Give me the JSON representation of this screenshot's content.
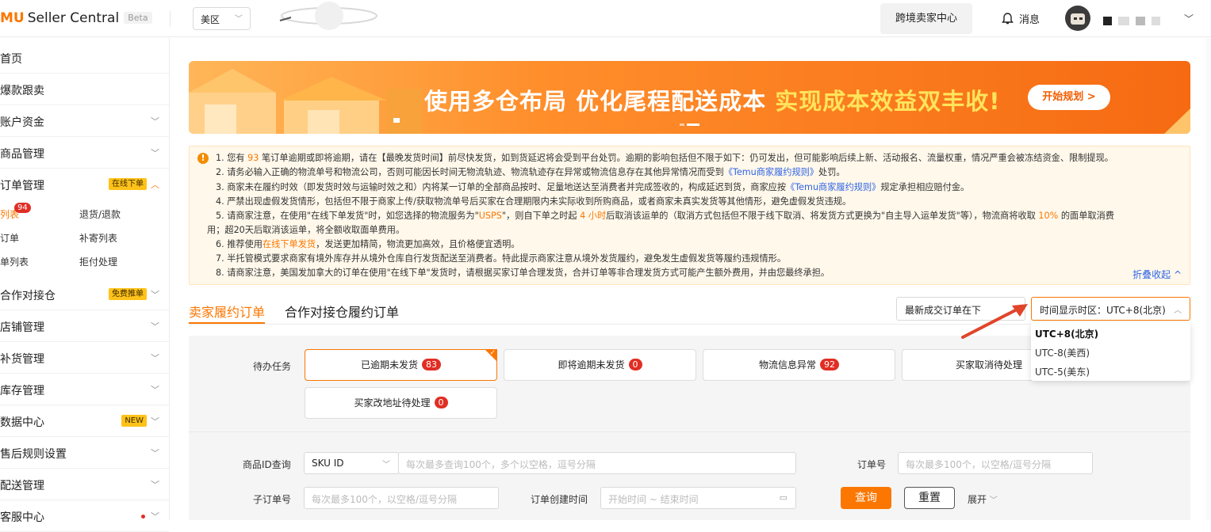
{
  "header": {
    "logo_mark": "MU",
    "logo_text": "Seller Central",
    "beta": "Beta",
    "region": "美区",
    "cross_border": "跨境卖家中心",
    "messages": "消息"
  },
  "sidebar": {
    "items": [
      {
        "label": "首页"
      },
      {
        "label": "爆款跟卖"
      },
      {
        "label": "账户资金"
      },
      {
        "label": "商品管理"
      },
      {
        "label": "订单管理",
        "badge": "在线下单"
      },
      {
        "label": "合作对接仓",
        "badge": "免费推单"
      },
      {
        "label": "店铺管理"
      },
      {
        "label": "补货管理"
      },
      {
        "label": "库存管理"
      },
      {
        "label": "数据中心",
        "badge": "NEW"
      },
      {
        "label": "售后规则设置"
      },
      {
        "label": "配送管理"
      },
      {
        "label": "客服中心"
      }
    ],
    "order_sub": {
      "list": "列表",
      "list_count": "94",
      "returns": "退货/退款",
      "orders": "订单",
      "resend": "补寄列表",
      "shiplist": "单列表",
      "chargeback": "拒付处理"
    }
  },
  "banner": {
    "text_white": "使用多仓布局 优化尾程配送成本 ",
    "text_yellow": "实现成本效益双丰收!",
    "button": "开始规划 >"
  },
  "notice": {
    "l1a": "1. 您有 ",
    "l1n": "93",
    "l1b": " 笔订单逾期或即将逾期，请在【最晚发货时间】前尽快发货，如到货延迟将会受到平台处罚。逾期的影响包括但不限于如下：仍可发出，但可能影响后续上新、活动报名、流量权重，情况严重会被冻结资金、限制提现。",
    "l2a": "2. 请务必输入正确的物流单号和物流公司，否则可能因长时间无物流轨迹、物流轨迹存在异常或物流信息存在其他异常情况而受到",
    "l2link": "《Temu商家履约规则》",
    "l2b": "处罚。",
    "l3a": "3. 商家未在履约时效（即发货时效与运输时效之和）内将某一订单的全部商品按时、足量地送达至消费者并完成签收的，构成延迟到货，商家应按",
    "l3link": "《Temu商家履约规则》",
    "l3b": "规定承担相应赔付金。",
    "l4": "4. 严禁出现虚假发货情形，包括但不限于商家上传/获取物流单号后买家在合理期限内未实际收到所购商品，或者商家未真实发货等其他情形，避免虚假发货违规。",
    "l5a": "5. 请商家注意，在使用\"在线下单发货\"时，如您选择的物流服务为\"",
    "l5usps": "USPS",
    "l5b": "\"，则自下单之时起 ",
    "l5h": "4 小时",
    "l5c": "后取消该运单的（取消方式包括但不限于线下取消、将发货方式更换为\"自主导入运单发货\"等），物流商将收取 ",
    "l5p": "10%",
    "l5d": " 的面单取消费",
    "l5e": "用；超20天后取消该运单，将全额收取面单费用。",
    "l6a": "6. 推荐使用",
    "l6link": "在线下单发货",
    "l6b": "，发送更加精简，物流更加高效，且价格便宜透明。",
    "l7": "7. 半托管模式要求商家有境外库存并从境外仓库自行发货配送至消费者。特此提示商家注意从境外发货履约，避免发生虚假发货等履约违规情形。",
    "l8": "8. 请商家注意，美国发加拿大的订单在使用\"在线下单\"发货时，请根据买家订单合理发货，合并订单等非合理发货方式可能产生额外费用，并由您最终承担。",
    "fold": "折叠收起 ^"
  },
  "tabs": [
    "卖家履约订单",
    "合作对接仓履约订单"
  ],
  "sort": "最新成交订单在下",
  "timezone": {
    "label": "时间显示时区：UTC+8(北京)",
    "options": [
      "UTC+8(北京)",
      "UTC-8(美西)",
      "UTC-5(美东)"
    ]
  },
  "tasks": {
    "label": "待办任务",
    "items": [
      {
        "name": "已逾期未发货",
        "count": "83"
      },
      {
        "name": "即将逾期未发货",
        "count": "0"
      },
      {
        "name": "物流信息异常",
        "count": "92"
      },
      {
        "name": "买家取消待处理",
        "count": ""
      },
      {
        "name": "买家改地址待处理",
        "count": "0"
      }
    ]
  },
  "filters": {
    "product_id_label": "商品ID查询",
    "sku_select": "SKU ID",
    "product_id_placeholder": "每次最多查询100个，多个以空格，逗号分隔",
    "order_no_label": "订单号",
    "order_no_placeholder": "每次最多100个，以空格/逗号分隔",
    "sub_order_label": "子订单号",
    "sub_order_placeholder": "每次最多100个，以空格/逗号分隔",
    "create_time_label": "订单创建时间",
    "create_time_placeholder": "开始时间 ~ 结束时间",
    "query": "查询",
    "reset": "重置",
    "expand": "展开"
  },
  "colors": {
    "accent": "#fb7701",
    "badge_red": "#e02e24",
    "link": "#2f64e5"
  }
}
